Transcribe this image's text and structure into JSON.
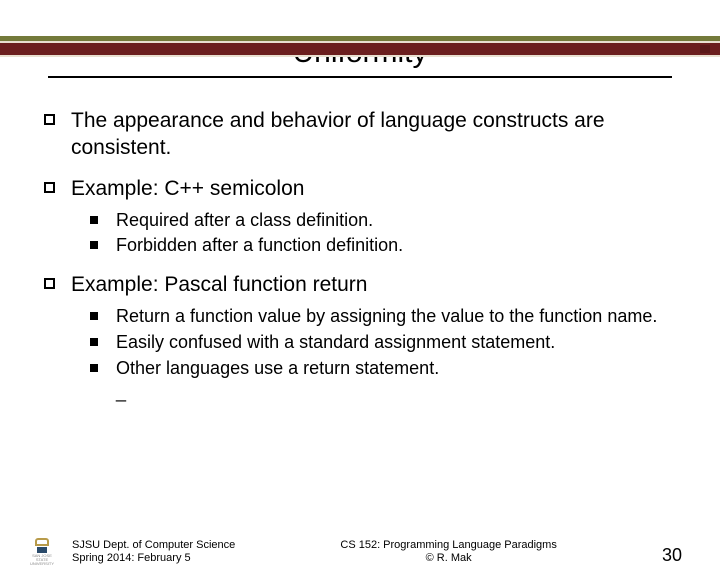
{
  "title": "Uniformity",
  "bullets": {
    "b0": "The appearance and behavior of language constructs are consistent.",
    "b1": "Example: C++ semicolon",
    "b1_subs": {
      "s0": "Required after a class definition.",
      "s1": "Forbidden after a function definition."
    },
    "b2": "Example: Pascal function return",
    "b2_subs": {
      "s0": "Return a function value by assigning the value to the function name.",
      "s1": "Easily confused with a standard assignment statement.",
      "s2": "Other languages use a return statement.",
      "s3": "_"
    }
  },
  "footer": {
    "left_line1": "SJSU Dept. of Computer Science",
    "left_line2": "Spring 2014: February 5",
    "center_line1": "CS 152: Programming Language Paradigms",
    "center_line2": "© R. Mak",
    "page": "30"
  },
  "logo_text": "SAN JOSE STATE UNIVERSITY"
}
